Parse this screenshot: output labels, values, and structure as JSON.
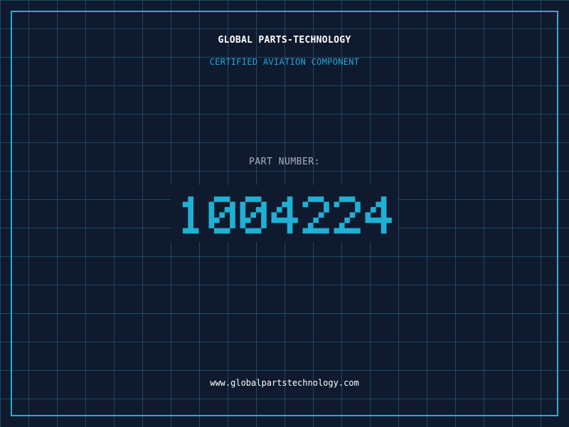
{
  "header": {
    "company": "GLOBAL PARTS-TECHNOLOGY",
    "tagline": "CERTIFIED AVIATION COMPONENT"
  },
  "part": {
    "label": "PART NUMBER:",
    "number": "1004224"
  },
  "footer": {
    "website": "www.globalpartstechnology.com"
  },
  "colors": {
    "background": "#0f1a2e",
    "grid": "#286e8c",
    "frame": "#1fb0d4",
    "digits": "#1fb0d4",
    "tagline": "#1fa9d6",
    "label": "#a9b3c2",
    "text": "#ffffff"
  }
}
